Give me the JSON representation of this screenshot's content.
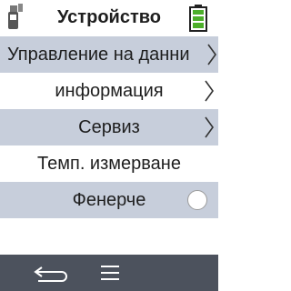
{
  "header": {
    "title": "Устройство",
    "device_icon": "device-icon",
    "battery_icon": "battery-full-icon",
    "battery_color": "#4caf2a"
  },
  "menu": {
    "items": [
      {
        "label": "Управление на данни",
        "trailing": "chevron-right-icon"
      },
      {
        "label": "информация",
        "trailing": "chevron-right-icon"
      },
      {
        "label": "Сервиз",
        "trailing": "chevron-right-icon"
      },
      {
        "label": "Темп. измерване",
        "trailing": ""
      },
      {
        "label": "Фенерче",
        "trailing": "toggle-off",
        "toggle_on": false
      }
    ]
  },
  "footer": {
    "back_icon": "back-arrow-icon",
    "menu_icon": "hamburger-menu-icon",
    "bar_color": "#4c525d"
  },
  "colors": {
    "row_shaded": "#c7cedb",
    "row_plain": "#ffffff",
    "text": "#1e1e1e"
  }
}
